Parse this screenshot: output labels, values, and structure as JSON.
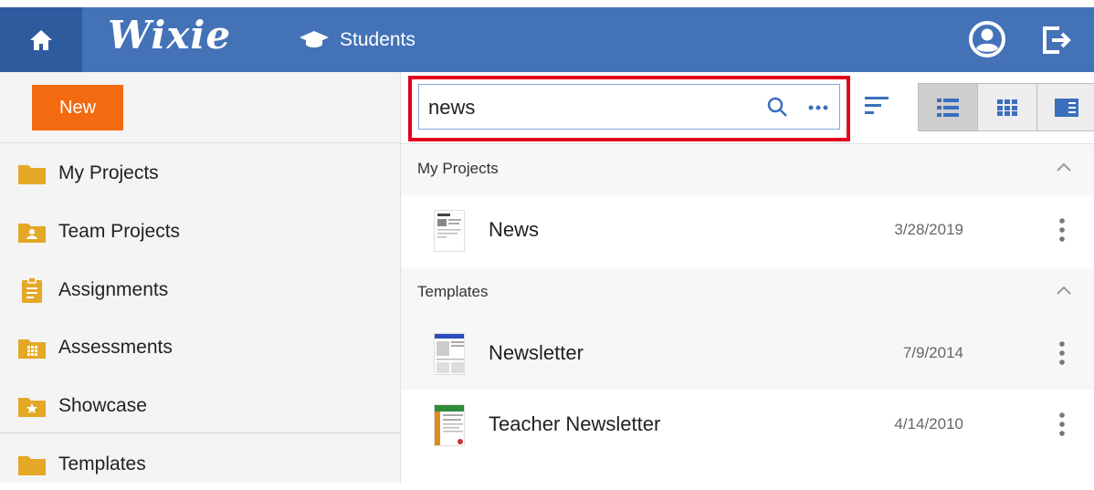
{
  "header": {
    "logo_text": "Wixie",
    "students_label": "Students",
    "brand_color": "#4472b7",
    "home_bg": "#2e5a9e"
  },
  "sidebar": {
    "new_label": "New",
    "items": [
      {
        "label": "My Projects",
        "icon": "folder-icon"
      },
      {
        "label": "Team Projects",
        "icon": "team-folder-icon"
      },
      {
        "label": "Assignments",
        "icon": "clipboard-icon"
      },
      {
        "label": "Assessments",
        "icon": "grid-folder-icon"
      },
      {
        "label": "Showcase",
        "icon": "star-folder-icon"
      },
      {
        "label": "Templates",
        "icon": "folder-icon"
      }
    ]
  },
  "search": {
    "value": "news",
    "placeholder": ""
  },
  "sections": [
    {
      "title": "My Projects",
      "rows": [
        {
          "name": "News",
          "date": "3/28/2019"
        }
      ]
    },
    {
      "title": "Templates",
      "rows": [
        {
          "name": "Newsletter",
          "date": "7/9/2014"
        },
        {
          "name": "Teacher Newsletter",
          "date": "4/14/2010"
        }
      ]
    }
  ],
  "colors": {
    "accent_orange": "#f36a10",
    "highlight_red": "#e3001b",
    "folder_yellow": "#e4a827"
  }
}
